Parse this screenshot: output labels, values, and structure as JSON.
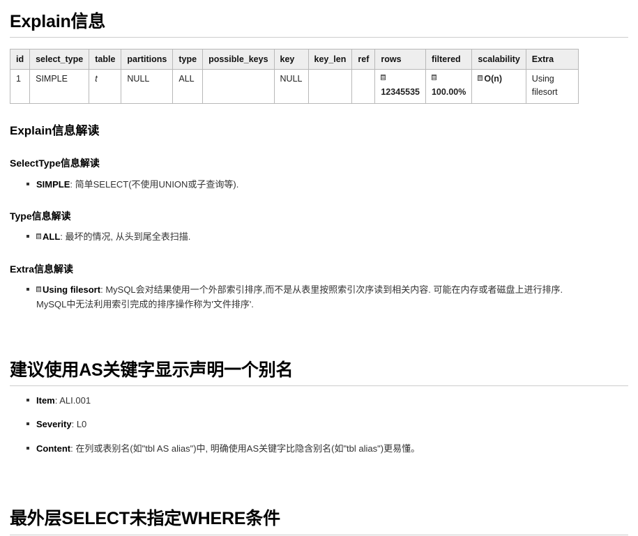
{
  "sections": {
    "explain_info": {
      "heading": "Explain信息"
    },
    "explain_interpret": {
      "heading": "Explain信息解读",
      "select_type": {
        "heading": "SelectType信息解读",
        "items": [
          {
            "term": "SIMPLE",
            "sep": ": ",
            "desc": "简单SELECT(不使用UNION或子查询等).",
            "icon": false
          }
        ]
      },
      "type": {
        "heading": "Type信息解读",
        "items": [
          {
            "term": "ALL",
            "sep": ": ",
            "desc": "最坏的情况, 从头到尾全表扫描.",
            "icon": true
          }
        ]
      },
      "extra": {
        "heading": "Extra信息解读",
        "items": [
          {
            "term": "Using filesort",
            "sep": ": ",
            "desc": "MySQL会对结果使用一个外部索引排序,而不是从表里按照索引次序读到相关内容. 可能在内存或者磁盘上进行排序. MySQL中无法利用索引完成的排序操作称为'文件排序'.",
            "icon": true
          }
        ]
      }
    },
    "as_keyword": {
      "heading": "建议使用AS关键字显示声明一个别名",
      "items": [
        {
          "term": "Item",
          "sep": ": ",
          "desc": "ALI.001"
        },
        {
          "term": "Severity",
          "sep": ": ",
          "desc": "L0"
        },
        {
          "term": "Content",
          "sep": ": ",
          "desc": "在列或表别名(如\"tbl AS alias\")中, 明确使用AS关键字比隐含别名(如\"tbl alias\")更易懂。"
        }
      ]
    },
    "no_where": {
      "heading": "最外层SELECT未指定WHERE条件"
    }
  },
  "explain_table": {
    "columns": [
      "id",
      "select_type",
      "table",
      "partitions",
      "type",
      "possible_keys",
      "key",
      "key_len",
      "ref",
      "rows",
      "filtered",
      "scalability",
      "Extra"
    ],
    "rows": [
      {
        "id": "1",
        "select_type": "SIMPLE",
        "table": "t",
        "partitions": "NULL",
        "type": "ALL",
        "possible_keys": "",
        "key": "NULL",
        "key_len": "",
        "ref": "",
        "rows": "12345535",
        "filtered": "100.00%",
        "scalability": "O(n)",
        "extra": "Using filesort"
      }
    ]
  },
  "colors": {
    "text": "#333333",
    "heading": "#000000",
    "rule": "#cccccc",
    "table_border": "#b8b8b8",
    "table_header_bg": "#eeeeee"
  }
}
